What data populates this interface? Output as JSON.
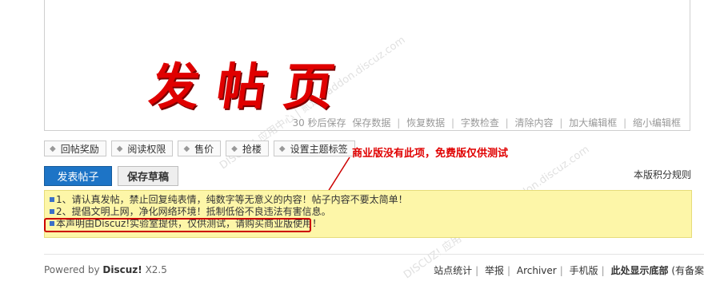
{
  "editor": {
    "status_items": [
      "30 秒后保存",
      "保存数据",
      "恢复数据",
      "字数检查",
      "清除内容",
      "加大编辑框",
      "缩小编辑框"
    ]
  },
  "overlay": {
    "big_title": "发帖页",
    "annotation": "商业版没有此项，免费版仅供测试",
    "annotation_color": "#e00000"
  },
  "watermark": {
    "text": "DISCUZ! 应用中心 | 贰道 · addon.discuz.com"
  },
  "options": [
    {
      "label": "回帖奖励"
    },
    {
      "label": "阅读权限"
    },
    {
      "label": "售价"
    },
    {
      "label": "抢楼"
    },
    {
      "label": "设置主题标签"
    }
  ],
  "actions": {
    "submit_label": "发表帖子",
    "save_draft_label": "保存草稿",
    "credit_rules_label": "本版积分规则",
    "submit_color": "#1d74c6"
  },
  "notice": {
    "lines": [
      "1、请认真发帖，禁止回复纯表情，纯数字等无意义的内容！帖子内容不要太简单！",
      "2、提倡文明上网，净化网络环境！抵制低俗不良违法有害信息。",
      "本声明由Discuz!实验室提供，仅供测试，请购买商业版使用！"
    ],
    "background": "#fdf6a8"
  },
  "footer": {
    "powered_prefix": "Powered by",
    "powered_brand": "Discuz!",
    "powered_version": "X2.5",
    "links": [
      "站点统计",
      "举报",
      "Archiver",
      "手机版",
      "此处显示底部",
      "(有备案"
    ]
  }
}
